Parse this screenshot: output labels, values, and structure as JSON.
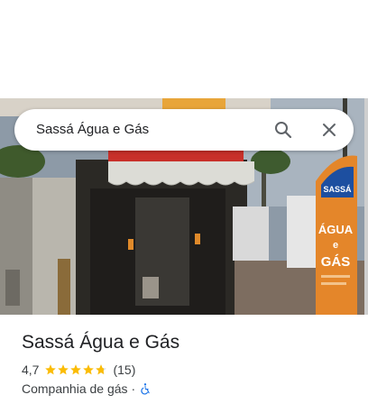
{
  "search": {
    "query": "Sassá Água e Gás",
    "search_icon": "search-icon",
    "clear_icon": "close-icon"
  },
  "photo": {
    "sign_line_1": "ÁGUA",
    "sign_line_2": "e",
    "sign_line_3": "GÁS",
    "sign_logo": "SASSÁ"
  },
  "place": {
    "name": "Sassá Água e Gás",
    "rating": "4,7",
    "stars_filled": 4.7,
    "stars_total": 5,
    "review_count": "(15)",
    "category": "Companhia de gás",
    "separator": "·",
    "accessibility_icon": "wheelchair-icon"
  },
  "colors": {
    "star": "#fbbc04",
    "accessible": "#1a73e8",
    "text_primary": "#202124",
    "text_secondary": "#3c4043"
  }
}
